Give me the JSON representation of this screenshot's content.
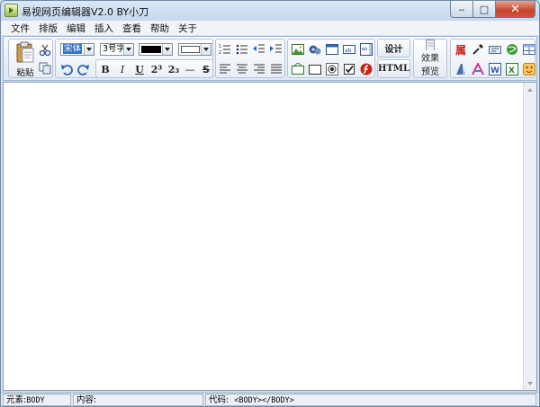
{
  "window": {
    "title": "易视网页编辑器V2.0 BY小刀",
    "min_glyph": "‒",
    "max_glyph": "□",
    "close_glyph": "✕"
  },
  "menu": [
    "文件",
    "排版",
    "编辑",
    "插入",
    "查看",
    "帮助",
    "关于"
  ],
  "toolbar": {
    "paste_label": "粘贴",
    "font_family": "宋体",
    "font_size": "3号字",
    "foreground_color": "#000000",
    "background_color": "#ffffff",
    "superscript_label": "2³",
    "subscript_label": "2₃",
    "bold_label": "B",
    "italic_label": "I",
    "underline_label": "U",
    "hr_label": "—",
    "strike_label": "S",
    "design_label": "设计",
    "html_label": "HTML",
    "preview_label_1": "效果",
    "preview_label_2": "预览"
  },
  "status": {
    "element_label": "元素:",
    "element_value": "BODY",
    "content_label": "内容:",
    "content_value": "",
    "code_label": "代码:",
    "code_value": "<BODY></BODY>"
  },
  "colors": {
    "accent": "#3370cc",
    "close_red": "#c7432a"
  }
}
